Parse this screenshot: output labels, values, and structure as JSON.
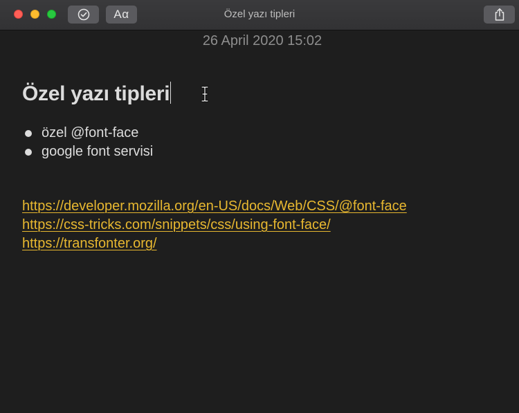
{
  "window": {
    "title": "Özel yazı tipleri"
  },
  "toolbar": {
    "checklist_icon": "checklist-icon",
    "format_label": "Aα",
    "share_icon": "share-icon"
  },
  "note": {
    "date": "26 April 2020 15:02",
    "title": "Özel yazı tipleri",
    "bullets": [
      "özel @font-face",
      "google font servisi"
    ],
    "links": [
      "https://developer.mozilla.org/en-US/docs/Web/CSS/@font-face",
      "https://css-tricks.com/snippets/css/using-font-face/",
      "https://transfonter.org/"
    ]
  },
  "colors": {
    "background": "#1e1e1e",
    "link": "#e8b830",
    "text": "#dcdcdc"
  }
}
